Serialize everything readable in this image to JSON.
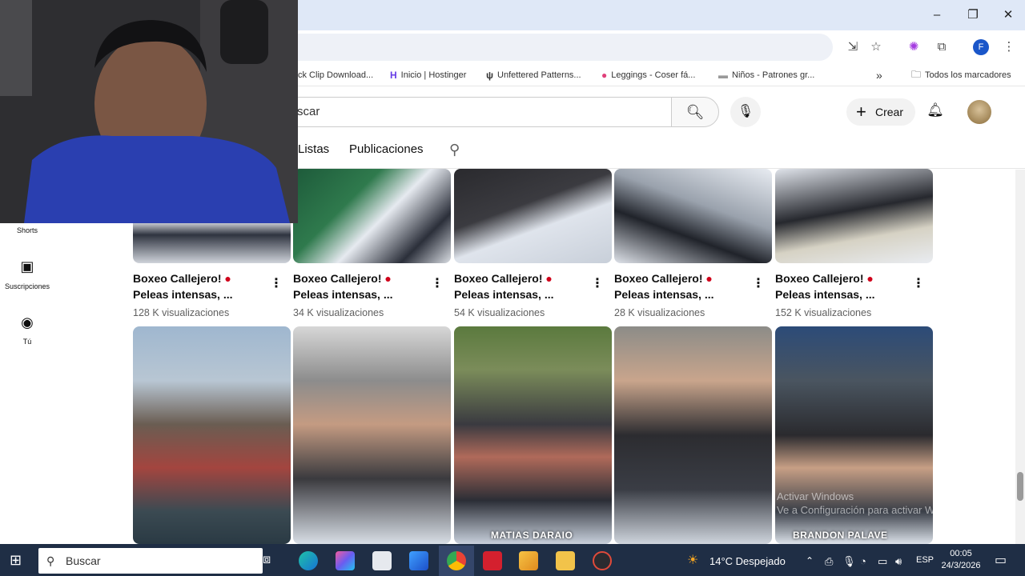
{
  "browser": {
    "window_buttons": [
      "–",
      "❐",
      "✕"
    ],
    "toolbar_icons": [
      "install-icon",
      "star-icon",
      "extension-color-icon",
      "puzzle-icon",
      "profile-icon",
      "menu-icon"
    ],
    "profile_initial": "F",
    "bookmarks": [
      {
        "icon": "page-icon",
        "label": "ck Clip Download..."
      },
      {
        "icon": "hostinger-icon",
        "label": "Inicio | Hostinger"
      },
      {
        "icon": "wp-icon",
        "label": "Unfettered Patterns..."
      },
      {
        "icon": "leggings-icon",
        "label": "Leggings - Coser fá..."
      },
      {
        "icon": "ninos-icon",
        "label": "Niños - Patrones gr..."
      }
    ],
    "bookmarks_more": "»",
    "all_bookmarks_label": "Todos los marcadores"
  },
  "youtube": {
    "search_placeholder": "scar",
    "create_label": "Crear",
    "channel_tabs": [
      "Listas",
      "Publicaciones"
    ],
    "sidebar": [
      {
        "label": "Shorts",
        "icon": "shorts-icon"
      },
      {
        "label": "Suscripciones",
        "icon": "subscriptions-icon"
      },
      {
        "label": "Tú",
        "icon": "you-icon"
      }
    ],
    "videos_row1": [
      {
        "title_line1": "Boxeo Callejero!",
        "title_line2": "Peleas intensas, ...",
        "views": "128 K visualizaciones"
      },
      {
        "title_line1": "Boxeo Callejero!",
        "title_line2": "Peleas intensas, ...",
        "views": "34 K visualizaciones"
      },
      {
        "title_line1": "Boxeo Callejero!",
        "title_line2": "Peleas intensas, ...",
        "views": "54 K visualizaciones"
      },
      {
        "title_line1": "Boxeo Callejero!",
        "title_line2": "Peleas intensas, ...",
        "views": "28 K visualizaciones"
      },
      {
        "title_line1": "Boxeo Callejero!",
        "title_line2": "Peleas intensas, ...",
        "views": "152 K visualizaciones"
      }
    ],
    "videos_row2_labels": [
      "",
      "",
      "MATIAS DARAIO",
      "",
      "BRANDON PALAVE"
    ],
    "watermark_line1": "Activar Windows",
    "watermark_line2": "Ve a Configuración para activar Windows."
  },
  "taskbar": {
    "search_placeholder": "Buscar",
    "weather": "14°C  Despejado",
    "language": "ESP",
    "time": "00:05",
    "date": "24/3/2026"
  }
}
